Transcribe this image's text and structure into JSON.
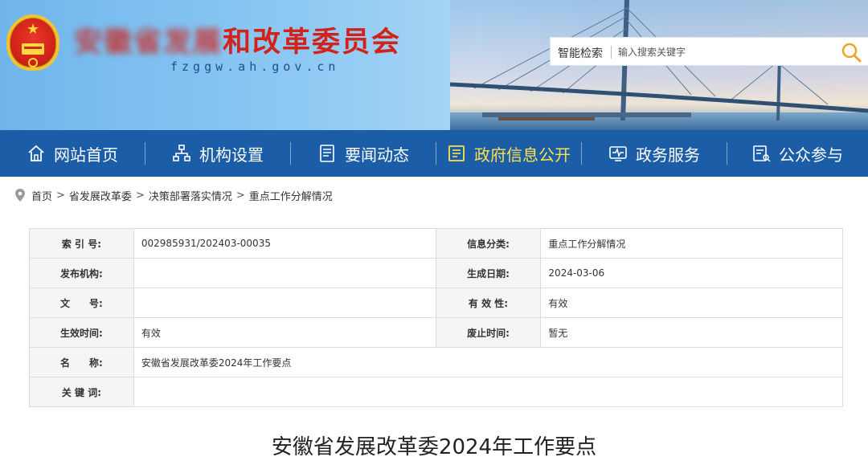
{
  "header": {
    "site_title_blurred": "安徽省发展",
    "site_title_visible": "和改革委员会",
    "domain": "fzggw.ah.gov.cn"
  },
  "search": {
    "label": "智能检索",
    "placeholder": "输入搜索关键字",
    "icon": "search-icon"
  },
  "nav": {
    "items": [
      {
        "label": "网站首页",
        "icon": "home-icon"
      },
      {
        "label": "机构设置",
        "icon": "org-chart-icon"
      },
      {
        "label": "要闻动态",
        "icon": "news-icon"
      },
      {
        "label": "政府信息公开",
        "icon": "info-public-icon",
        "active": true
      },
      {
        "label": "政务服务",
        "icon": "service-icon"
      },
      {
        "label": "公众参与",
        "icon": "participation-icon"
      }
    ],
    "active_color": "#ffe14d",
    "bg_color": "#1b5da7"
  },
  "breadcrumb": {
    "icon": "location-pin-icon",
    "items": [
      "首页",
      "省发展改革委",
      "决策部署落实情况",
      "重点工作分解情况"
    ],
    "separator": ">"
  },
  "info": {
    "index_label": "索 引 号:",
    "index_value": "002985931/202403-00035",
    "category_label": "信息分类:",
    "category_value": "重点工作分解情况",
    "publisher_label": "发布机构:",
    "publisher_value": "",
    "date_label": "生成日期:",
    "date_value": "2024-03-06",
    "docno_label": "文　　号:",
    "docno_value": "",
    "validity_label": "有 效 性:",
    "validity_value": "有效",
    "effective_label": "生效时间:",
    "effective_value": "有效",
    "repeal_label": "废止时间:",
    "repeal_value": "暂无",
    "name_label": "名　　称:",
    "name_value": "安徽省发展改革委2024年工作要点",
    "keywords_label": "关 键 词:",
    "keywords_value": ""
  },
  "article": {
    "title": "安徽省发展改革委2024年工作要点"
  }
}
